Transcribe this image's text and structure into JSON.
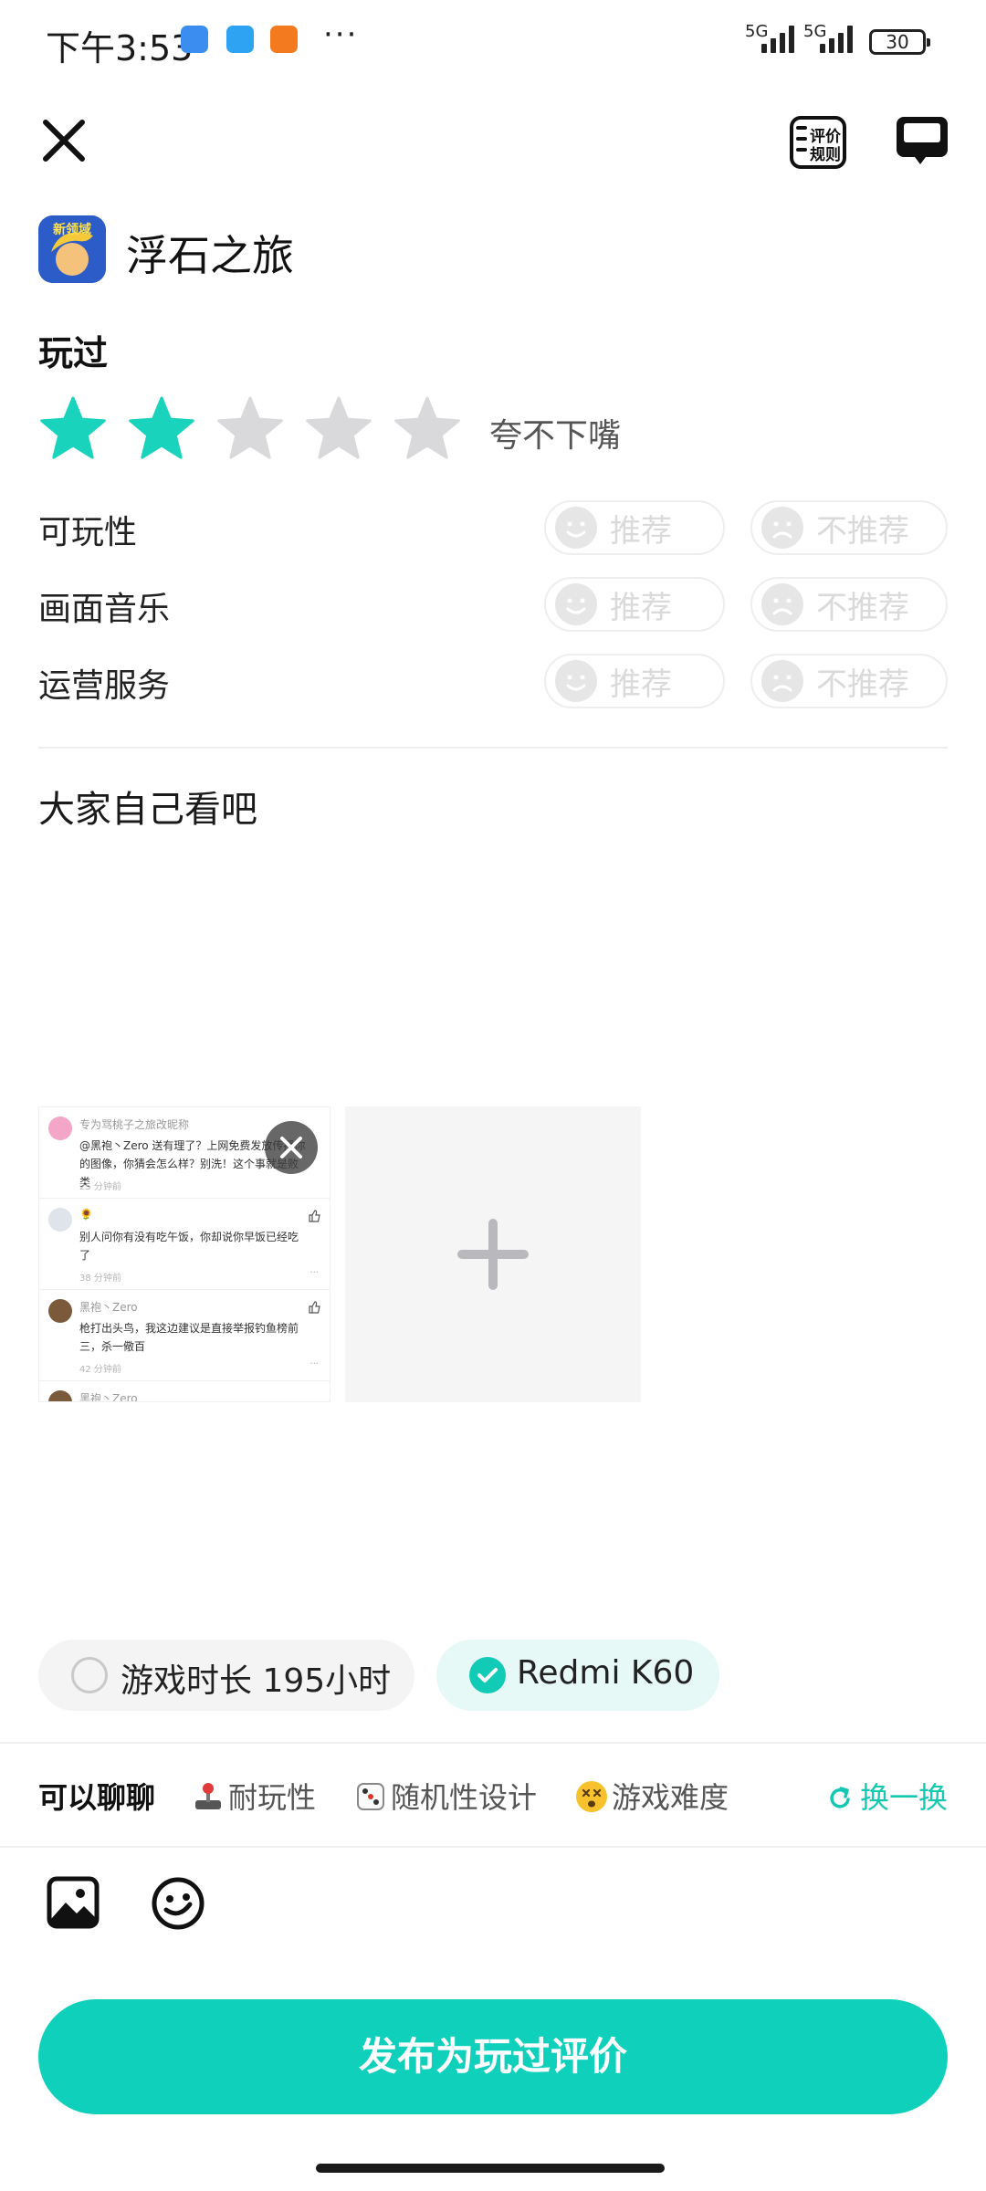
{
  "status_bar": {
    "time": "下午3:53",
    "dots": "···",
    "signal1_label": "5G",
    "signal2_label": "5G",
    "battery": "30"
  },
  "header": {
    "rules_line1": "评价",
    "rules_line2": "规则"
  },
  "game": {
    "name": "浮石之旅",
    "icon_text": "新领域"
  },
  "review": {
    "status_label": "玩过",
    "rating": 2,
    "max_rating": 5,
    "rating_text": "夸不下嘴",
    "aspects": [
      {
        "label": "可玩性",
        "recommend": "推荐",
        "not_recommend": "不推荐"
      },
      {
        "label": "画面音乐",
        "recommend": "推荐",
        "not_recommend": "不推荐"
      },
      {
        "label": "运营服务",
        "recommend": "推荐",
        "not_recommend": "不推荐"
      }
    ],
    "text": "大家自己看吧"
  },
  "attached_image": {
    "comments": [
      {
        "name": "专为骂桃子之旅改昵称",
        "text": "@黑袍丶Zero 送有理了？上网免费发放传播你的图像，你猜会怎么样？别洗！这个事就是败类",
        "time": "25 分钟前"
      },
      {
        "name": "🌻",
        "text": "别人问你有没有吃午饭，你却说你早饭已经吃了",
        "time": "38 分钟前"
      },
      {
        "name": "黑袍丶Zero",
        "text": "枪打出头鸟，我这边建议是直接举报钓鱼榜前三，杀一儆百",
        "time": "42 分钟前"
      },
      {
        "name": "黑袍丶Zero",
        "text": "",
        "time": ""
      }
    ]
  },
  "tags": {
    "play_time": "游戏时长 195小时",
    "device": "Redmi K60"
  },
  "topics": {
    "label": "可以聊聊",
    "items": [
      "耐玩性",
      "随机性设计",
      "游戏难度"
    ],
    "shuffle": "换一换"
  },
  "publish_button": "发布为玩过评价",
  "colors": {
    "accent": "#0fd1bb",
    "star_active": "#19d3bd",
    "star_inactive": "#d9d9db"
  }
}
